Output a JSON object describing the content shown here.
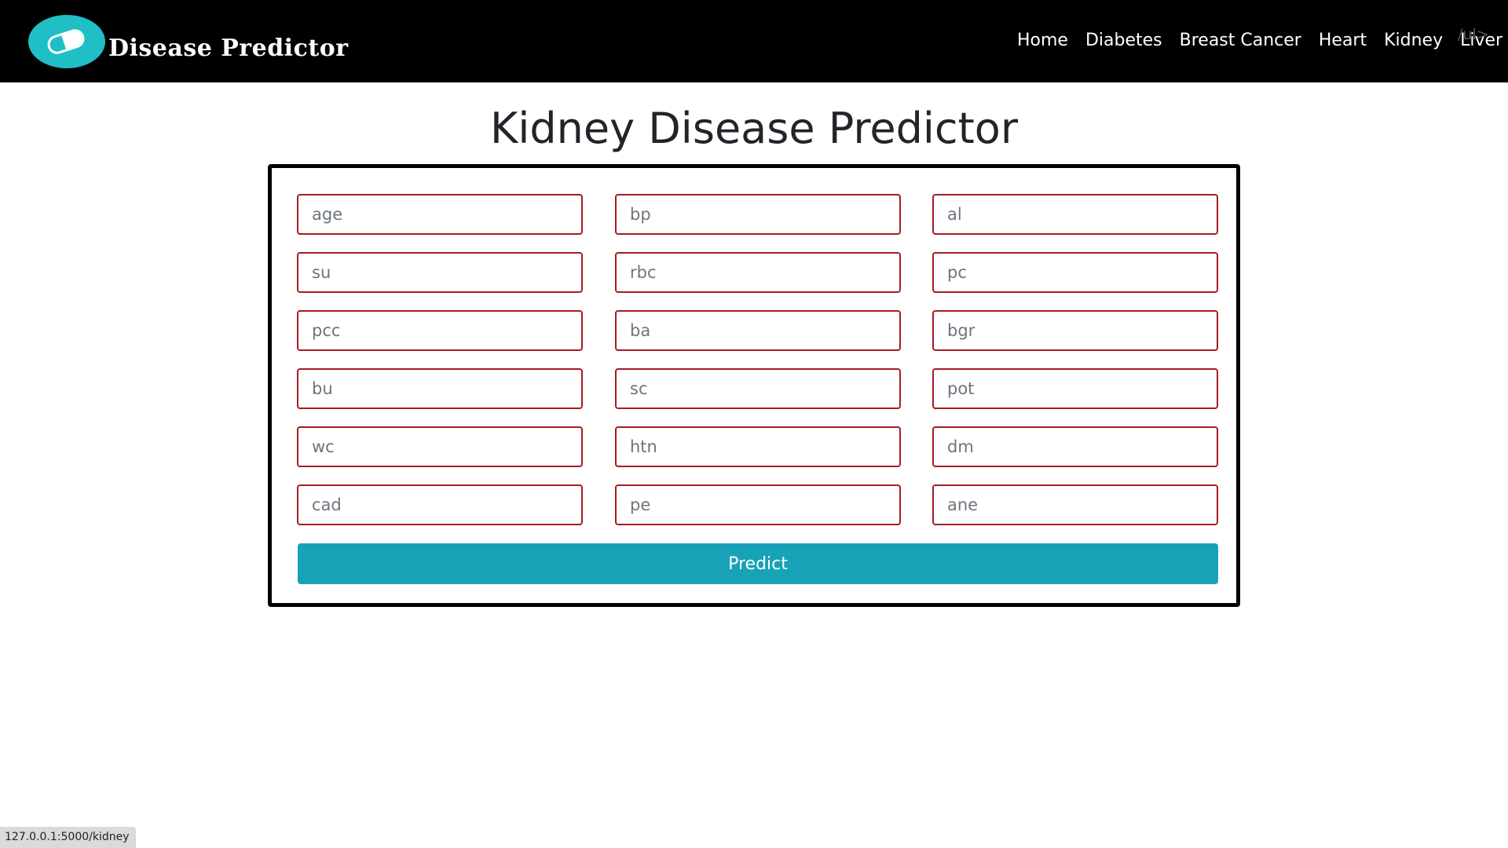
{
  "navbar": {
    "brand_text": "Disease Predictor",
    "links": [
      "Home",
      "Diabetes",
      "Breast Cancer",
      "Heart",
      "Kidney",
      "Liver"
    ],
    "stray_text": "/ul>"
  },
  "page_title": "Kidney Disease Predictor",
  "form": {
    "fields": [
      {
        "placeholder": "age",
        "value": ""
      },
      {
        "placeholder": "bp",
        "value": ""
      },
      {
        "placeholder": "al",
        "value": ""
      },
      {
        "placeholder": "su",
        "value": ""
      },
      {
        "placeholder": "rbc",
        "value": ""
      },
      {
        "placeholder": "pc",
        "value": ""
      },
      {
        "placeholder": "pcc",
        "value": ""
      },
      {
        "placeholder": "ba",
        "value": ""
      },
      {
        "placeholder": "bgr",
        "value": ""
      },
      {
        "placeholder": "bu",
        "value": ""
      },
      {
        "placeholder": "sc",
        "value": ""
      },
      {
        "placeholder": "pot",
        "value": ""
      },
      {
        "placeholder": "wc",
        "value": ""
      },
      {
        "placeholder": "htn",
        "value": ""
      },
      {
        "placeholder": "dm",
        "value": ""
      },
      {
        "placeholder": "cad",
        "value": ""
      },
      {
        "placeholder": "pe",
        "value": ""
      },
      {
        "placeholder": "ane",
        "value": ""
      }
    ],
    "submit_label": "Predict"
  },
  "status_bar": {
    "url": "127.0.0.1:5000/kidney"
  },
  "colors": {
    "navbar_bg": "#000000",
    "logo_accent": "#20bfc6",
    "field_border": "#a61c22",
    "button_bg": "#17a2b8"
  },
  "icons": {
    "logo": "pill-capsule-icon"
  }
}
